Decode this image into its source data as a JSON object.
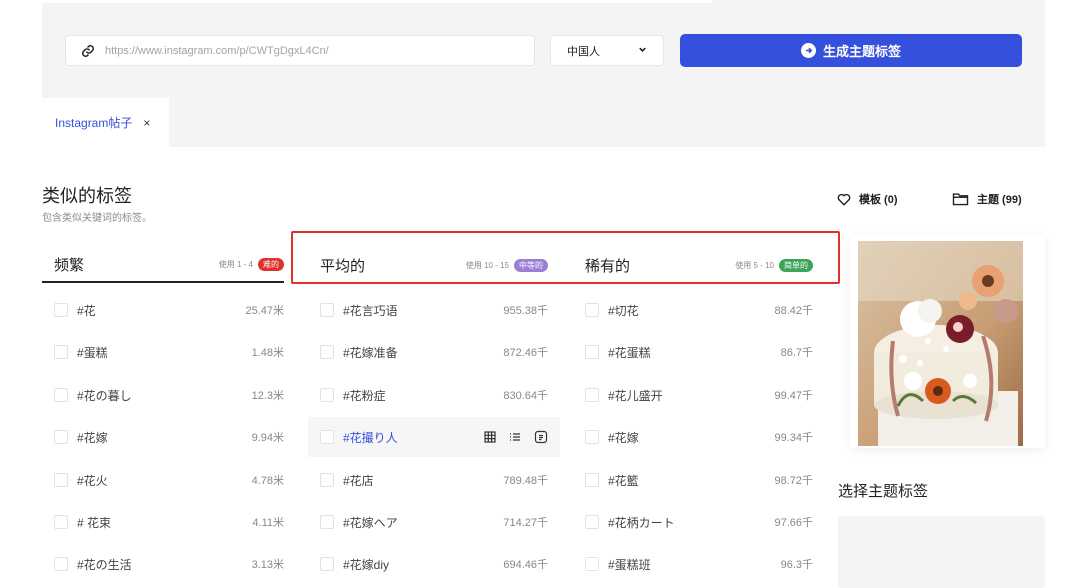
{
  "search": {
    "url_placeholder": "https://www.instagram.com/p/CWTgDgxL4Cn/",
    "language_value": "中国人",
    "generate_label": "生成主题标签"
  },
  "tabs": [
    {
      "label": "Instagram帖子",
      "close_label": "×"
    }
  ],
  "section": {
    "title": "类似的标签",
    "subtitle": "包含类似关键词的标签。"
  },
  "columns": {
    "frequent": {
      "name": "频繁",
      "usage": "使用 1 - 4",
      "badge": "难的",
      "badge_color": "#e0312f"
    },
    "average": {
      "name": "平均的",
      "usage": "使用 10 - 15",
      "badge": "中等的",
      "badge_color": "#9b7fd4"
    },
    "rare": {
      "name": "稀有的",
      "usage": "使用 5 - 10",
      "badge": "简单的",
      "badge_color": "#3aa55b"
    }
  },
  "frequent_rows": [
    {
      "tag": "#花",
      "count": "25.47米"
    },
    {
      "tag": "#蛋糕",
      "count": "1.48米"
    },
    {
      "tag": "#花の暮し",
      "count": "12.3米"
    },
    {
      "tag": "#花嫁",
      "count": "9.94米"
    },
    {
      "tag": "#花火",
      "count": "4.78米"
    },
    {
      "tag": "# 花束",
      "count": "4.11米"
    },
    {
      "tag": "#花の生活",
      "count": "3.13米"
    }
  ],
  "average_rows": [
    {
      "tag": "#花言巧语",
      "count": "955.38千"
    },
    {
      "tag": "#花嫁准备",
      "count": "872.46千"
    },
    {
      "tag": "#花粉症",
      "count": "830.64千"
    },
    {
      "tag": "#花撮り人",
      "count": ""
    },
    {
      "tag": "#花店",
      "count": "789.48千"
    },
    {
      "tag": "#花嫁ヘア",
      "count": "714.27千"
    },
    {
      "tag": "#花嫁diy",
      "count": "694.46千"
    }
  ],
  "rare_rows": [
    {
      "tag": "#切花",
      "count": "88.42千"
    },
    {
      "tag": "#花蛋糕",
      "count": "86.7千"
    },
    {
      "tag": "#花儿盛开",
      "count": "99.47千"
    },
    {
      "tag": "#花嫁",
      "count": "99.34千"
    },
    {
      "tag": "#花籃",
      "count": "98.72千"
    },
    {
      "tag": "#花柄カート",
      "count": "97.66千"
    },
    {
      "tag": "#蛋糕班",
      "count": "96.3千"
    }
  ],
  "sidebar": {
    "templates_label": "模板 (0)",
    "themes_label": "主题 (99)",
    "select_theme_title": "选择主题标签"
  },
  "icons": {
    "link": "link-icon",
    "dropdown": "chevron-down-icon",
    "generate": "arrow-right-circle-icon",
    "heart": "heart-icon",
    "folder": "folder-icon",
    "grid": "grid-icon",
    "list": "list-icon",
    "copy": "copy-icon"
  },
  "colors": {
    "accent": "#3450dc",
    "highlight_frame": "#e0312f"
  }
}
